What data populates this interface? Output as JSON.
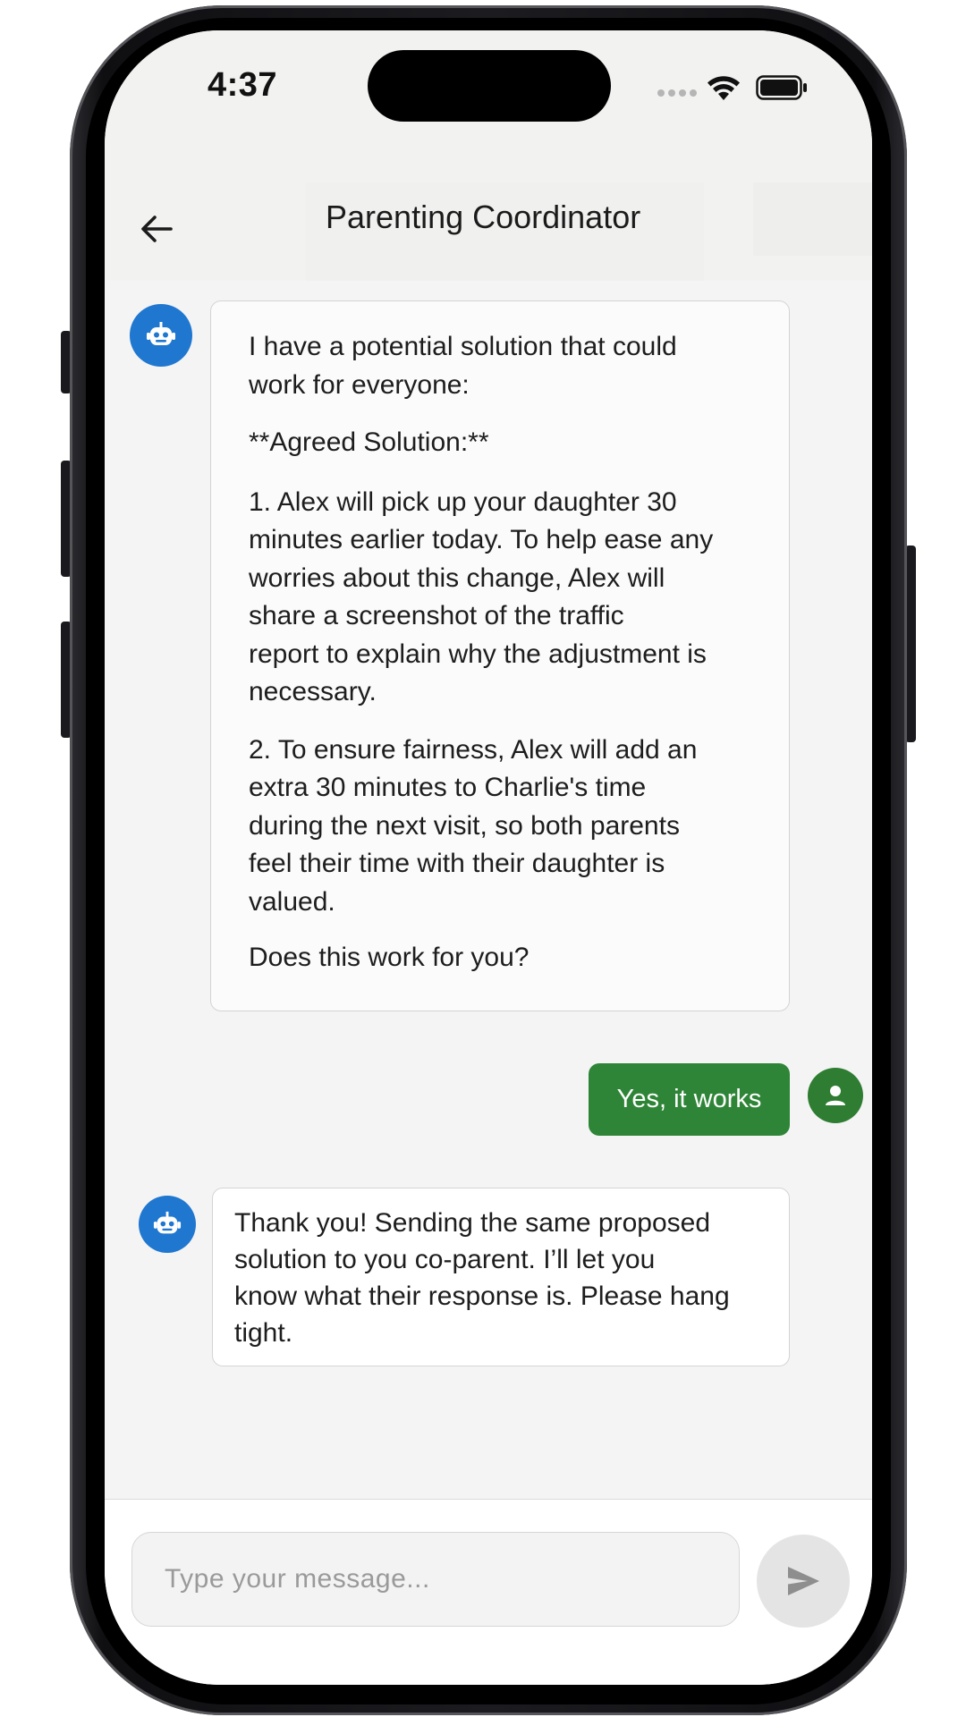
{
  "status_bar": {
    "time": "4:37",
    "icons": [
      "signal-dots-icon",
      "wifi-icon",
      "battery-icon"
    ]
  },
  "header": {
    "title": "Parenting Coordinator",
    "back_icon": "arrow-left-icon"
  },
  "messages": [
    {
      "sender": "bot",
      "avatar_icon": "robot-icon",
      "paragraphs": [
        "I have a potential solution that could\nwork for everyone:",
        "**Agreed Solution:**",
        "1. Alex will pick up your daughter 30\nminutes earlier today. To help ease any\nworries about this change, Alex will\nshare a screenshot of the traffic\nreport to explain why the adjustment is\nnecessary.",
        "2. To ensure fairness, Alex will add an\nextra 30 minutes to Charlie's time\nduring the next visit, so both parents\nfeel their time with their daughter is\nvalued.",
        "Does this work for you?"
      ]
    },
    {
      "sender": "user",
      "avatar_icon": "person-icon",
      "text": "Yes, it works"
    },
    {
      "sender": "bot",
      "avatar_icon": "robot-icon",
      "text": "Thank you! Sending the same proposed\nsolution to you co-parent. I’ll let you\nknow what their response is. Please hang\ntight."
    }
  ],
  "composer": {
    "placeholder": "Type your message...",
    "value": "",
    "send_icon": "send-icon"
  },
  "colors": {
    "bot_avatar": "#1f77d0",
    "user_bubble": "#2f8537",
    "user_avatar": "#2e7d32",
    "background": "#f4f4f4"
  }
}
